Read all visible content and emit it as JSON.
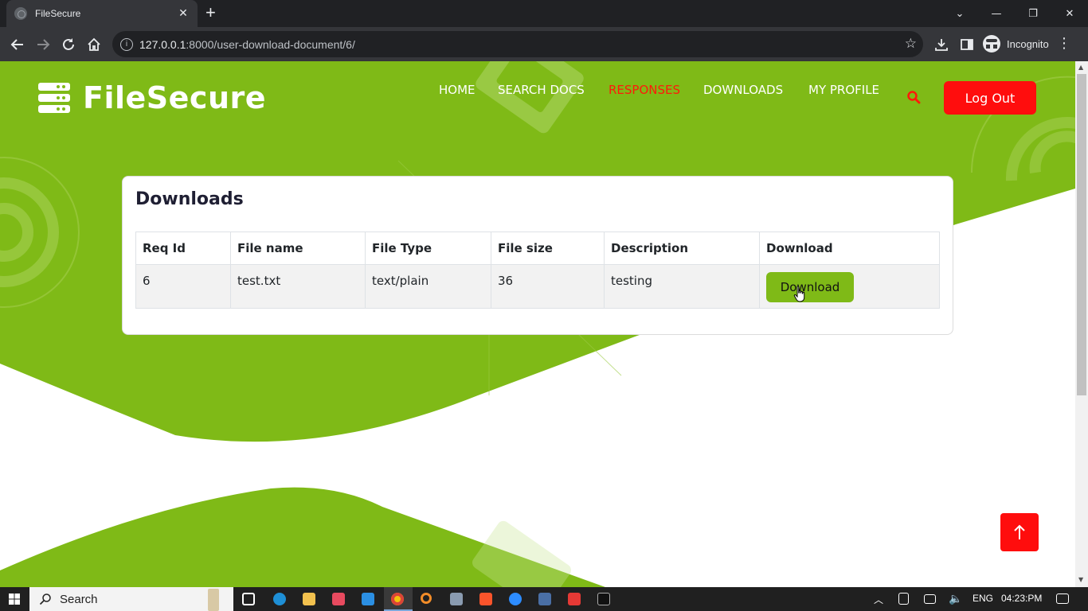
{
  "browser": {
    "tab_title": "FileSecure",
    "tab_close": "✕",
    "new_tab": "+",
    "url_host": "127.0.0.1",
    "url_path": ":8000/user-download-document/6/",
    "profile_label": "Incognito",
    "window_controls": {
      "dropdown": "⌄",
      "minimize": "—",
      "restore": "❐",
      "close": "✕"
    }
  },
  "site": {
    "brand": "FileSecure",
    "nav": [
      {
        "label": "HOME",
        "active": false
      },
      {
        "label": "SEARCH DOCS",
        "active": false
      },
      {
        "label": "RESPONSES",
        "active": true
      },
      {
        "label": "DOWNLOADS",
        "active": false
      },
      {
        "label": "MY PROFILE",
        "active": false
      }
    ],
    "logout_label": "Log Out",
    "colors": {
      "primary_green": "#7fba17",
      "accent_red": "#ff0d0d",
      "nav_active": "#ff1a0a"
    }
  },
  "downloads": {
    "heading": "Downloads",
    "columns": [
      "Req Id",
      "File name",
      "File Type",
      "File size",
      "Description",
      "Download"
    ],
    "rows": [
      {
        "req_id": "6",
        "file_name": "test.txt",
        "file_type": "text/plain",
        "file_size": "36",
        "description": "testing",
        "action": "Download"
      }
    ]
  },
  "taskbar": {
    "search_label": "Search",
    "language": "ENG",
    "time": "04:23:PM"
  }
}
